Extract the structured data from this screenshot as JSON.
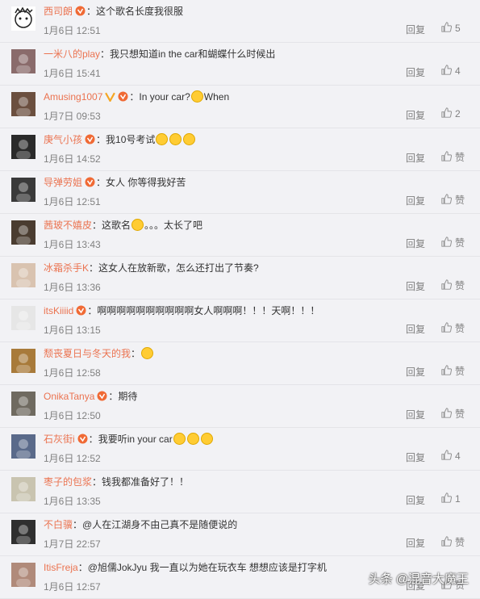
{
  "comments": [
    {
      "user": "西司朗",
      "badge": "vip",
      "sep": "：",
      "text": "这个歌名长度我很服",
      "emojis": [],
      "date": "1月6日 12:51",
      "reply": "回复",
      "likes": "5",
      "avatar_color": "#ffffff"
    },
    {
      "user": "一米八的play",
      "badge": "",
      "sep": "：",
      "text": "我只想知道in the car和蝴蝶什么时候出",
      "emojis": [],
      "date": "1月6日 15:41",
      "reply": "回复",
      "likes": "4",
      "avatar_color": "#8a6b6b"
    },
    {
      "user": "Amusing1007",
      "badge": "v+vip",
      "sep": "：",
      "text": "In your car?",
      "emojis": [
        "sweat-smile"
      ],
      "text_after": "When",
      "date": "1月7日 09:53",
      "reply": "回复",
      "likes": "2",
      "avatar_color": "#6b4f3f"
    },
    {
      "user": "庚气小孩",
      "badge": "vip",
      "sep": "：",
      "text": "我10号考试",
      "emojis": [
        "cry",
        "cry",
        "pray"
      ],
      "date": "1月6日 14:52",
      "reply": "回复",
      "likes": "赞",
      "avatar_color": "#2a2a2a"
    },
    {
      "user": "导弹劳姐",
      "badge": "vip",
      "sep": "：",
      "text": "女人 你等得我好苦",
      "emojis": [],
      "date": "1月6日 12:51",
      "reply": "回复",
      "likes": "赞",
      "avatar_color": "#3a3a3a"
    },
    {
      "user": "茜玻不嬉皮",
      "badge": "",
      "sep": "：",
      "text": "这歌名",
      "emojis": [
        "angry"
      ],
      "text_after": "。。。太长了吧",
      "date": "1月6日 13:43",
      "reply": "回复",
      "likes": "赞",
      "avatar_color": "#4a3c30"
    },
    {
      "user": "冰霜杀手K",
      "badge": "",
      "sep": "：",
      "text": "这女人在放新歌，怎么还打出了节奏?",
      "emojis": [],
      "date": "1月6日 13:36",
      "reply": "回复",
      "likes": "赞",
      "avatar_color": "#d9c3b0"
    },
    {
      "user": "itsKiiiid",
      "badge": "vip",
      "sep": "：",
      "text": "啊啊啊啊啊啊啊啊啊啊女人啊啊啊！！！天啊！！！",
      "emojis": [],
      "date": "1月6日 13:15",
      "reply": "回复",
      "likes": "赞",
      "avatar_color": "#e6e6e6"
    },
    {
      "user": "颓丧夏日与冬天的我",
      "badge": "",
      "sep": "：",
      "text": "",
      "emojis": [
        "cry"
      ],
      "date": "1月6日 12:58",
      "reply": "回复",
      "likes": "赞",
      "avatar_color": "#a87a3a"
    },
    {
      "user": "OnikaTanya",
      "badge": "vip",
      "sep": "：",
      "text": "期待",
      "emojis": [],
      "date": "1月6日 12:50",
      "reply": "回复",
      "likes": "赞",
      "avatar_color": "#6f6a60"
    },
    {
      "user": "石灰街i",
      "badge": "vip",
      "sep": "：",
      "text": "我要听in your car",
      "emojis": [
        "cry",
        "cry",
        "cry"
      ],
      "date": "1月6日 12:52",
      "reply": "回复",
      "likes": "4",
      "avatar_color": "#5a6a8a"
    },
    {
      "user": "枣子的包浆",
      "badge": "",
      "sep": "：",
      "text": "钱我都准备好了！！",
      "emojis": [],
      "date": "1月6日 13:35",
      "reply": "回复",
      "likes": "1",
      "avatar_color": "#c9c4b0"
    },
    {
      "user": "不白骥",
      "badge": "",
      "sep": "：",
      "text": "@人在江湖身不由己真不是随便说的",
      "emojis": [],
      "date": "1月7日 22:57",
      "reply": "回复",
      "likes": "赞",
      "avatar_color": "#2f2f2f"
    },
    {
      "user": "ItisFreja",
      "badge": "",
      "sep": "：",
      "text": "@旭儒JokJyu 我一直以为她在玩衣车 想想应该是打字机",
      "emojis": [],
      "date": "1月6日 12:57",
      "reply": "回复",
      "likes": "赞",
      "avatar_color": "#b08a7a"
    }
  ],
  "watermark": "头条 @混音大魔王"
}
